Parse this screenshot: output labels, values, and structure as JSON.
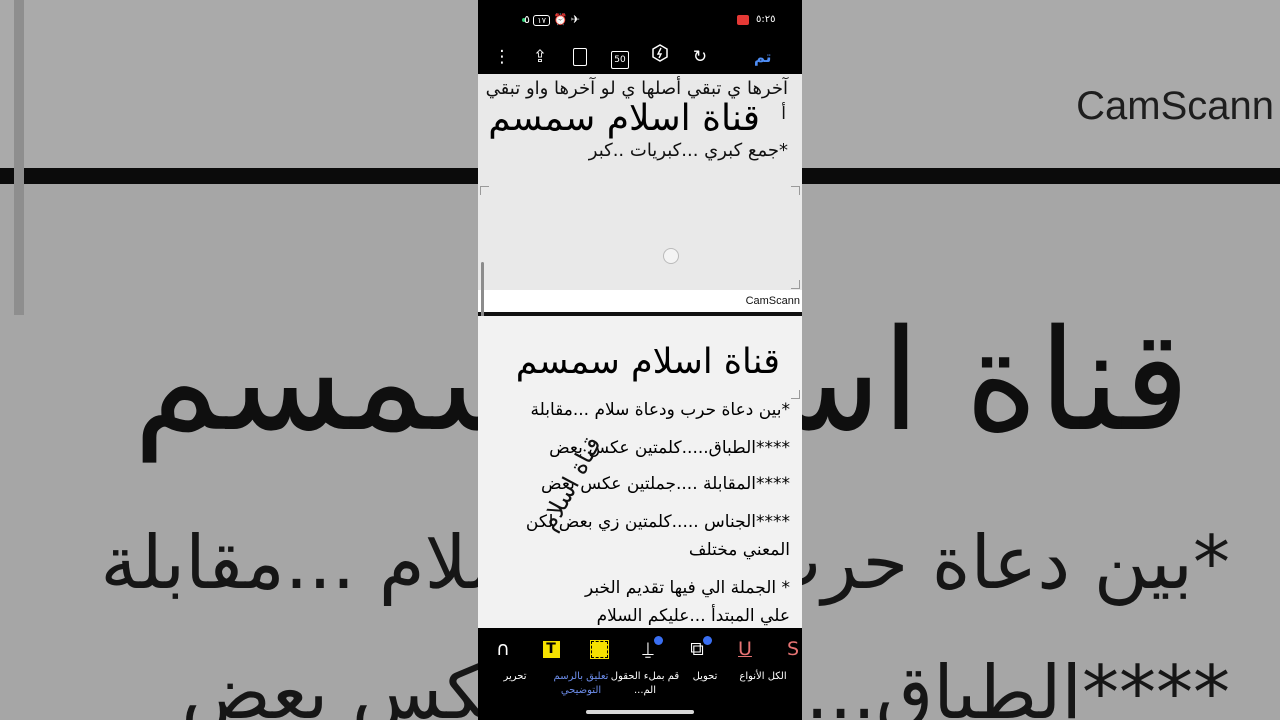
{
  "background": {
    "cam_label": "CamScann",
    "title": "قناة اسلام سمسم",
    "line1": "*بين دعاة حرب ودعاة سلام ...مقابلة",
    "line2": "****الطباق.....كلمتين عكس بعض"
  },
  "status_bar": {
    "time": "٥:٢٥",
    "battery": "١٧",
    "icons": "٥ ⏰ ✈"
  },
  "toolbar": {
    "done_label": "تم",
    "more_icon": "⋮",
    "share_icon": "⇪",
    "page50_label": "50",
    "rotate_icon": "↻"
  },
  "document": {
    "page1": {
      "line1": "آخرها ي تبقي أصلها ي لو آخرها واو تبقي",
      "hamza": "أ",
      "title": "قناة اسلام سمسم",
      "line2": "*جمع كبري ...كبريات ..كبر"
    },
    "cam_scanner": "CamScann",
    "page2": {
      "title": "قناة اسلام سمسم",
      "lines": [
        "*بين دعاة حرب ودعاة سلام ...مقابلة",
        "****الطباق.....كلمتين عكس بعض",
        "****المقابلة ....جملتين عكس بعض",
        "****الجناس .....كلمتين زي بعض لكن",
        "المعني مختلف",
        "* الجملة الي فيها تقديم الخبر",
        "علي المبتدأ ...عليكم السلام"
      ],
      "stamp": "قناة اسلام"
    }
  },
  "tools": {
    "icons": {
      "strike": "S",
      "underline": "U",
      "shapes": "⧉",
      "stamp": "⍊",
      "text": "T",
      "pen": "∩"
    },
    "labels": {
      "all_types": "الكل الأنواع",
      "convert": "تحويل",
      "fill_fields": "قم بملء الحقول الم...",
      "comment_drawing": "تعليق بالرسم التوضيحي",
      "edit": "تحرير"
    }
  },
  "colors": {
    "accent": "#4e8df5",
    "highlight": "#f5e100",
    "active_label": "#6c8ce8"
  }
}
